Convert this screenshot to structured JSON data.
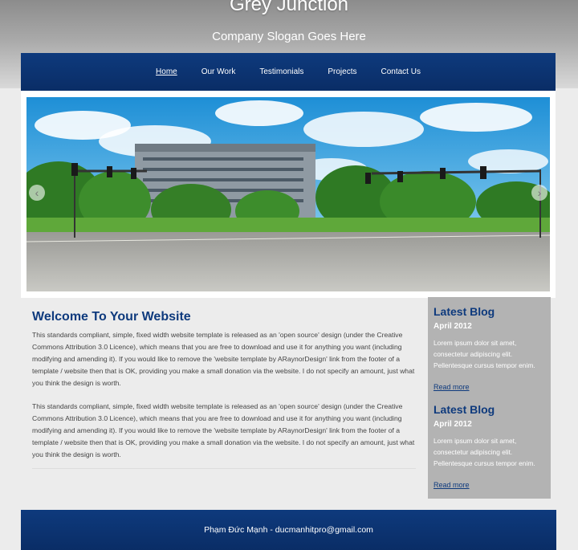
{
  "header": {
    "title": "Grey Junction",
    "slogan": "Company Slogan Goes Here"
  },
  "nav": {
    "items": [
      "Home",
      "Our Work",
      "Testimonials",
      "Projects",
      "Contact Us"
    ]
  },
  "slider": {
    "prev": "‹",
    "next": "›"
  },
  "main": {
    "title": "Welcome To Your Website",
    "paragraphs": [
      "This standards compliant, simple, fixed width website template is released as an 'open source' design (under the Creative Commons Attribution 3.0 Licence), which means that you are free to download and use it for anything you want (including modifying and amending it). If you would like to remove the 'website template by ARaynorDesign' link from the footer of a template / website then that is OK, providing you make a small donation via the website. I do not specify an amount, just what you think the design is worth.",
      "This standards compliant, simple, fixed width website template is released as an 'open source' design (under the Creative Commons Attribution 3.0 Licence), which means that you are free to download and use it for anything you want (including modifying and amending it). If you would like to remove the 'website template by ARaynorDesign' link from the footer of a template / website then that is OK, providing you make a small donation via the website. I do not specify an amount, just what you think the design is worth."
    ]
  },
  "sidebar": {
    "blogs": [
      {
        "title": "Latest Blog",
        "date": "April 2012",
        "text": "Lorem ipsum dolor sit amet, consectetur adipiscing elit. Pellentesque cursus tempor enim.",
        "link": "Read more"
      },
      {
        "title": "Latest Blog",
        "date": "April 2012",
        "text": "Lorem ipsum dolor sit amet, consectetur adipiscing elit. Pellentesque cursus tempor enim.",
        "link": "Read more"
      }
    ]
  },
  "footer": {
    "text": "Phạm Đức Mạnh - ducmanhitpro@gmail.com"
  },
  "colors": {
    "brand_blue": "#0e3a7d",
    "sidebar_grey": "#b3b3b3",
    "background": "#ececec"
  }
}
